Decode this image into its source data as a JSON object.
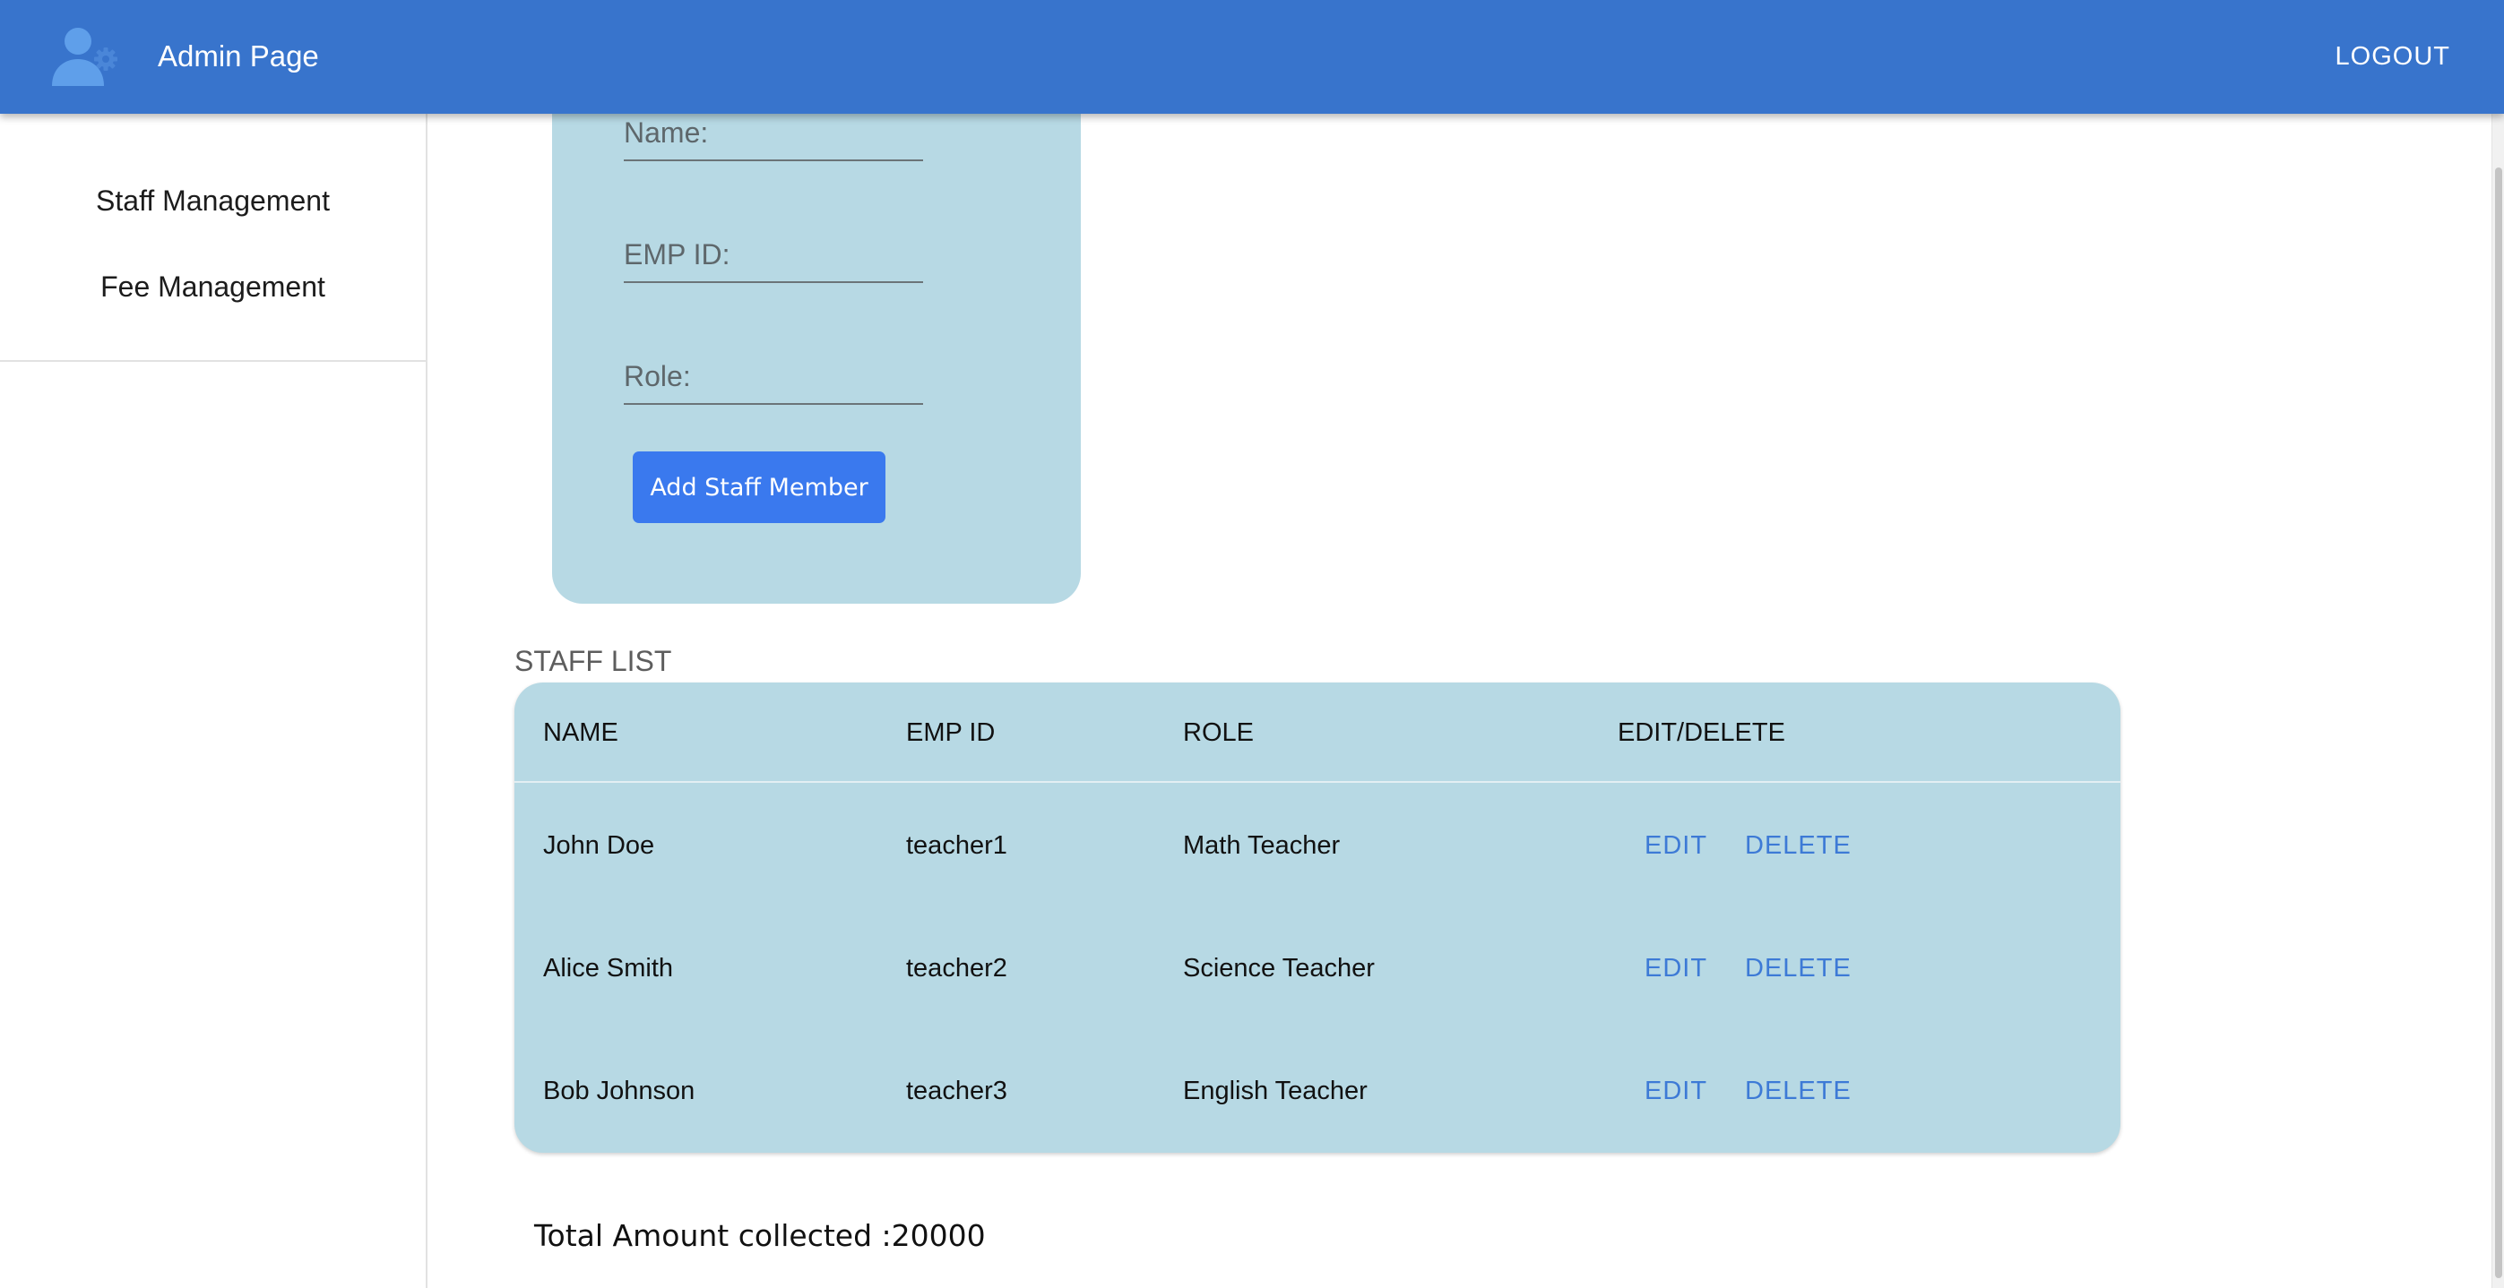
{
  "header": {
    "title": "Admin Page",
    "logout_label": "LOGOUT",
    "icon": "user-gear-icon"
  },
  "sidebar": {
    "items": [
      {
        "label": "Staff Management"
      },
      {
        "label": "Fee Management"
      }
    ]
  },
  "form": {
    "fields": [
      {
        "placeholder": "Name:",
        "value": ""
      },
      {
        "placeholder": "EMP ID:",
        "value": ""
      },
      {
        "placeholder": "Role:",
        "value": ""
      }
    ],
    "submit_label": "Add Staff Member"
  },
  "staff_list": {
    "title": "STAFF LIST",
    "columns": [
      "NAME",
      "EMP ID",
      "ROLE",
      "EDIT/DELETE"
    ],
    "rows": [
      {
        "name": "John Doe",
        "emp_id": "teacher1",
        "role": "Math Teacher",
        "edit_label": "EDIT",
        "delete_label": "DELETE"
      },
      {
        "name": "Alice Smith",
        "emp_id": "teacher2",
        "role": "Science Teacher",
        "edit_label": "EDIT",
        "delete_label": "DELETE"
      },
      {
        "name": "Bob Johnson",
        "emp_id": "teacher3",
        "role": "English Teacher",
        "edit_label": "EDIT",
        "delete_label": "DELETE"
      }
    ]
  },
  "footer": {
    "total_text": "Total Amount collected :20000"
  },
  "colors": {
    "appbar": "#3874cc",
    "card": "#b7d9e4",
    "primary_button": "#3a79ee",
    "action_link": "#3d7ad6"
  }
}
